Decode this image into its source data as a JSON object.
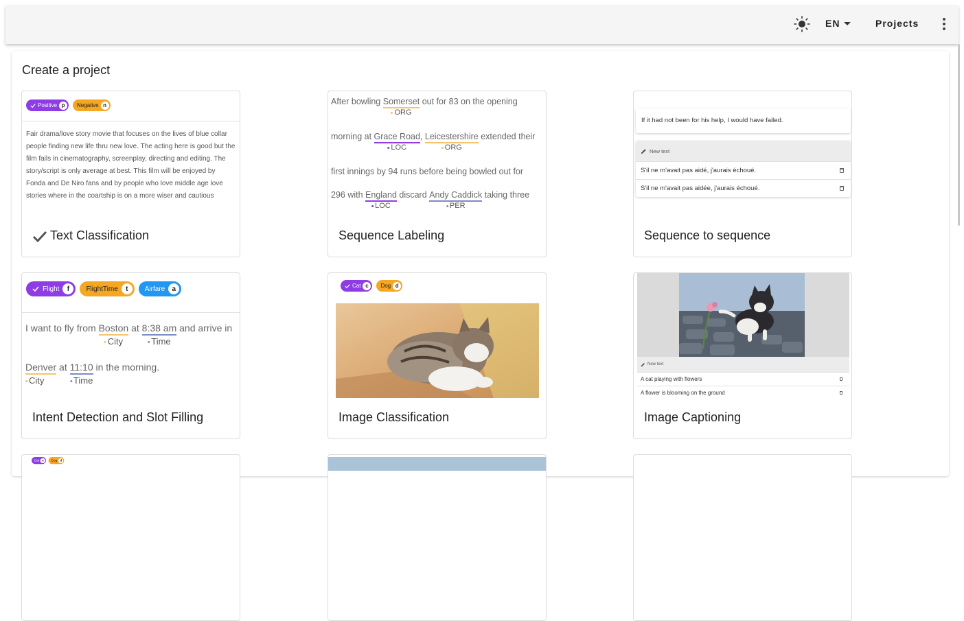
{
  "header": {
    "theme_icon": "sun-icon",
    "language": "EN",
    "projects_label": "Projects",
    "menu_icon": "dots-vertical-icon"
  },
  "page": {
    "title": "Create a project"
  },
  "cards": {
    "text_classification": {
      "title": "Text Classification",
      "selected": true,
      "labels": [
        {
          "text": "Positive",
          "key": "p",
          "color": "#8e3ce4"
        },
        {
          "text": "Negative",
          "key": "n",
          "color": "#f5a623"
        }
      ],
      "sample": "Fair drama/love story movie that focuses on the lives of blue collar people finding new life thru new love. The acting here is good but the film fails in cinematography, screenplay, directing and editing. The story/script is only average at best. This film will be enjoyed by Fonda and De Niro fans and by people who love middle age love stories where in the coartship is on a more wiser and cautious"
    },
    "sequence_labeling": {
      "title": "Sequence Labeling",
      "line1": {
        "pre": "After bowling ",
        "ent1": "Somerset",
        "ent1_label": "ORG",
        "post": " out for 83 on the opening"
      },
      "line2": {
        "pre": "morning at ",
        "ent1": "Grace Road",
        "ent1_label": "LOC",
        "mid": ", ",
        "ent2": "Leicestershire",
        "ent2_label": "ORG",
        "post": " extended their"
      },
      "line3": {
        "text": "first innings by 94 runs before being bowled out for"
      },
      "line4": {
        "pre": "296 with ",
        "ent1": "England",
        "ent1_label": "LOC",
        "mid": " discard ",
        "ent2": "Andy Caddick",
        "ent2_label": "PER",
        "post": " taking three"
      }
    },
    "seq2seq": {
      "title": "Sequence to sequence",
      "source": "If it had not been for his help, I would have failed.",
      "new_text_label": "New text",
      "targets": [
        "S'il ne m'avait pas aidé, j'aurais échoué.",
        "S'il ne m'avait pas aidée, j'aurais échoué."
      ]
    },
    "intent": {
      "title": "Intent Detection and Slot Filling",
      "labels": [
        {
          "text": "Flight",
          "key": "f",
          "color": "#8e3ce4"
        },
        {
          "text": "FlightTime",
          "key": "t",
          "color": "#f5a623"
        },
        {
          "text": "Airfare",
          "key": "a",
          "color": "#2196f3"
        }
      ],
      "line1": {
        "pre": "I want to fly from ",
        "ent1": "Boston",
        "ent1_label": "City",
        "mid": " at ",
        "ent2": "8:38 am",
        "ent2_label": "Time",
        "post": " and arrive in"
      },
      "line2": {
        "ent1": "Denver",
        "ent1_label": "City",
        "mid": " at ",
        "ent2": "11:10",
        "ent2_label": "Time",
        "post": " in the morning."
      }
    },
    "image_classification": {
      "title": "Image Classification",
      "labels": [
        {
          "text": "Cat",
          "key": "c",
          "color": "#8e3ce4"
        },
        {
          "text": "Dog",
          "key": "d",
          "color": "#f5a623"
        }
      ]
    },
    "image_captioning": {
      "title": "Image Captioning",
      "new_text_label": "New text",
      "captions": [
        "A cat playing with flowers",
        "A flower is blooming on the ground"
      ]
    },
    "partial_row": {
      "labels": [
        {
          "text": "Cat",
          "key": "c",
          "color": "#8e3ce4"
        },
        {
          "text": "Dog",
          "key": "d",
          "color": "#f5a623"
        }
      ]
    }
  },
  "colors": {
    "purple": "#8e3ce4",
    "orange": "#f5a623",
    "blue": "#2196f3",
    "loc_underline": "#8e3ce4",
    "org_underline": "#f5c36b",
    "per_underline": "#7b8cc4"
  }
}
